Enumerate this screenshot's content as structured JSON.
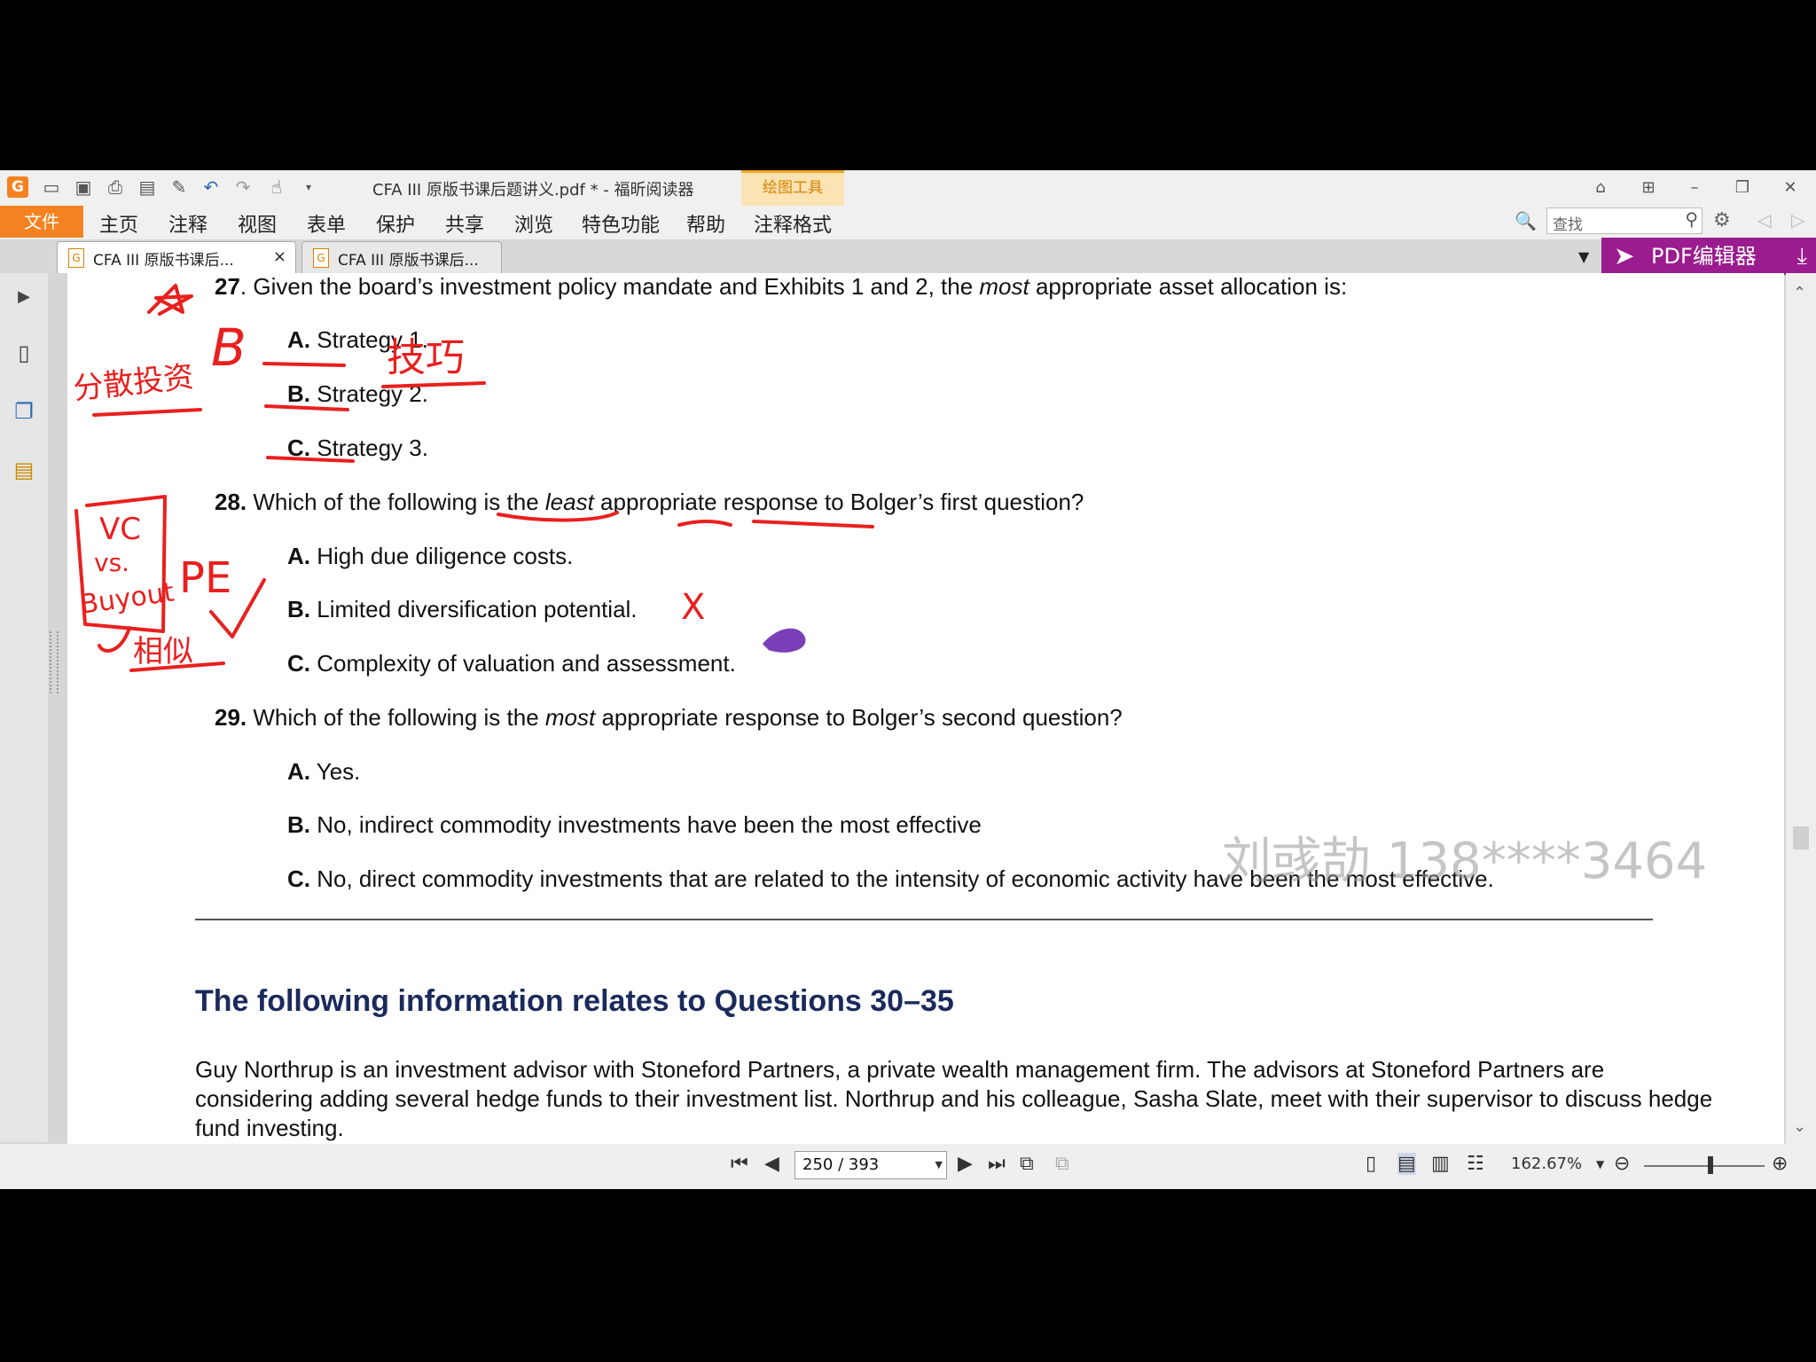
{
  "window": {
    "title": "CFA III 原版书课后题讲义.pdf * - 福昕阅读器",
    "context_tab": "绘图工具"
  },
  "menu": {
    "file": "文件",
    "items": [
      "主页",
      "注释",
      "视图",
      "表单",
      "保护",
      "共享",
      "浏览",
      "特色功能",
      "帮助",
      "注释格式"
    ],
    "search_placeholder": "查找"
  },
  "tabs": [
    {
      "label": "CFA III 原版书课后...",
      "close": "×"
    },
    {
      "label": "CFA III 原版书课后..."
    }
  ],
  "pdf_editor_button": "PDF编辑器",
  "document": {
    "q27": {
      "num": "27",
      "text_pre": ". Given the board’s investment policy mandate and Exhibits 1 and 2, the ",
      "text_em": "most",
      "text_post": " appropriate asset allocation is:",
      "options": [
        {
          "letter": "A.",
          "text": "Strategy 1."
        },
        {
          "letter": "B.",
          "text": "Strategy 2."
        },
        {
          "letter": "C.",
          "text": "Strategy 3."
        }
      ]
    },
    "q28": {
      "num": "28.",
      "text_pre": " Which of the following is the ",
      "text_em": "least",
      "text_post": " appropriate response to Bolger’s first question?",
      "options": [
        {
          "letter": "A.",
          "text": "High due diligence costs."
        },
        {
          "letter": "B.",
          "text": "Limited diversification potential."
        },
        {
          "letter": "C.",
          "text": "Complexity of valuation and assessment."
        }
      ]
    },
    "q29": {
      "num": "29.",
      "text_pre": " Which of the following is the ",
      "text_em": "most",
      "text_post": " appropriate response to Bolger’s second question?",
      "options": [
        {
          "letter": "A.",
          "text": "Yes."
        },
        {
          "letter": "B.",
          "text": "No, indirect commodity investments have been the most effective"
        },
        {
          "letter": "C.",
          "text": "No, direct commodity investments that are related to the intensity of economic activity have been the most effective."
        }
      ]
    },
    "section_heading": "The following information relates to Questions 30–35",
    "paragraph": "Guy Northrup is an investment advisor with Stoneford Partners, a private wealth management firm. The advisors at Stoneford Partners are considering adding several hedge funds to their investment list. Northrup and his colleague, Sasha Slate, meet with their supervisor to discuss hedge fund investing."
  },
  "annotations": {
    "answer_27": "B",
    "note_right_27": "技巧",
    "note_left_27": "分散投资",
    "box_text": [
      "VC",
      "vs.",
      "Buyout"
    ],
    "pe_label": "PE",
    "note_below_box": "相似",
    "wrong_mark": "X",
    "ink_color": "#e8201f",
    "purple_color": "#7a3fb8"
  },
  "watermark": "刘彧劼 138****3464",
  "status": {
    "page": "250 / 393",
    "zoom": "162.67%"
  }
}
